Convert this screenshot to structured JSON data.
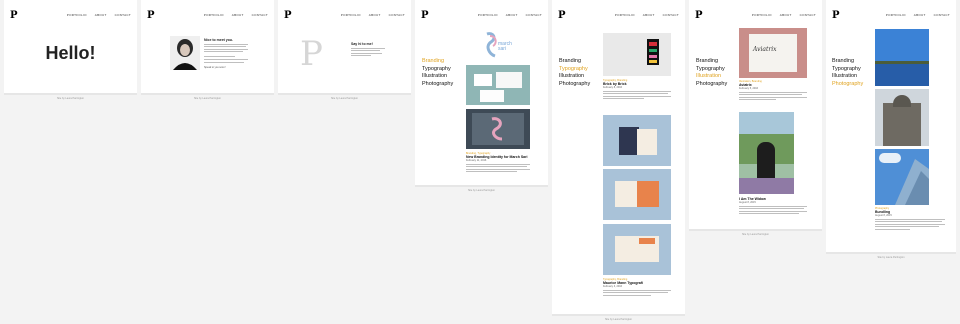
{
  "logo": "P",
  "nav": {
    "portfolio": "PORTFOLIO",
    "about": "ABOUT",
    "contact": "CONTACT"
  },
  "footer": "Site by Laura Parrington",
  "hello": "Hello!",
  "about": {
    "title": "Nice to meet you.",
    "sign_off": "Speak to you soon!"
  },
  "contact": {
    "monogram": "P",
    "title": "Say hi to me!"
  },
  "categories": [
    "Branding",
    "Typography",
    "Illustration",
    "Photography"
  ],
  "posts": {
    "march_sari": {
      "logo_line1": "march",
      "logo_line2": "sari",
      "category": "Branding, Typography",
      "title": "New Branding Identity for March Sari",
      "date": "February 11, 2016"
    },
    "brick": {
      "category": "Typography, Branding",
      "title": "Brick by Brick",
      "date": "February 8, 2016"
    },
    "maurice": {
      "category": "Typography, Branding",
      "title": "Maurice Mann Typografi",
      "date": "February 3, 2016"
    },
    "aviatrix": {
      "sketch_text": "Aviatrix",
      "category": "Illustration, Branding",
      "title": "Aviatrix",
      "date": "February 5, 2016"
    },
    "widow": {
      "category": "Photography, Illustration",
      "title": "I Am The Widow",
      "date": "August 8, 2015"
    },
    "bundling": {
      "category": "Photography",
      "title": "Bundling",
      "date": "August 8, 2015"
    }
  },
  "colors": {
    "accent": "#e0a320",
    "page_bg": "#ffffff",
    "strip_bg": "#f3f3f3"
  }
}
